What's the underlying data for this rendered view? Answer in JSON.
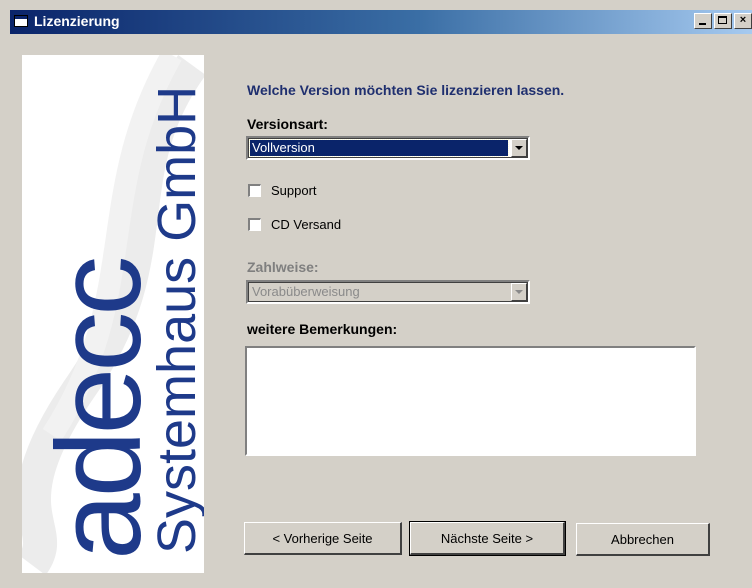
{
  "window": {
    "title": "Lizenzierung"
  },
  "titlebar_buttons": {
    "minimize": "minimize-button",
    "maximize": "maximize-button",
    "close_glyph": "×"
  },
  "logo": {
    "brand": "adecc",
    "subtitle": "Systemhaus GmbH",
    "color": "#1e3a8a"
  },
  "form": {
    "heading": "Welche Version möchten Sie lizenzieren lassen.",
    "version_label": "Versionsart:",
    "version_value": "Vollversion",
    "support_label": "Support",
    "support_checked": false,
    "cd_label": "CD Versand",
    "cd_checked": false,
    "payment_label": "Zahlweise:",
    "payment_value": "Vorabüberweisung",
    "remarks_label": "weitere Bemerkungen:",
    "remarks_value": ""
  },
  "buttons": {
    "prev": "< Vorherige Seite",
    "next": "Nächste Seite >",
    "cancel": "Abbrechen"
  }
}
